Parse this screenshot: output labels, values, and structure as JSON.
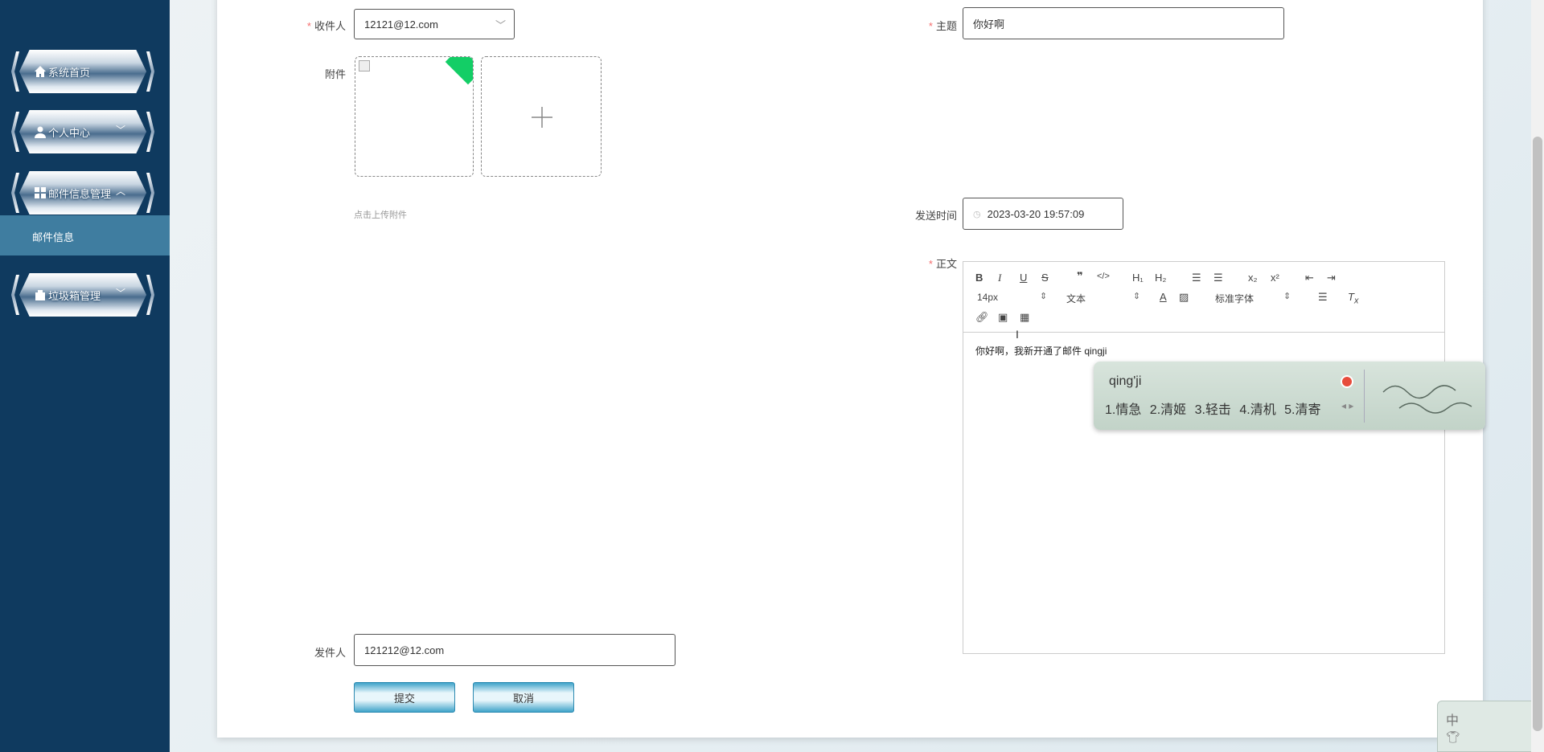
{
  "sidebar": {
    "items": [
      {
        "label": "系统首页",
        "icon": "home-icon"
      },
      {
        "label": "个人中心",
        "icon": "user-icon"
      },
      {
        "label": "邮件信息管理",
        "icon": "grid-icon"
      },
      {
        "label": "垃圾箱管理",
        "icon": "trash-icon"
      }
    ],
    "submenu": {
      "label": "邮件信息"
    }
  },
  "form": {
    "recipient": {
      "label": "收件人",
      "value": "12121@12.com"
    },
    "subject": {
      "label": "主题",
      "value": "你好啊"
    },
    "attachment": {
      "label": "附件",
      "tip": "点击上传附件"
    },
    "send_time": {
      "label": "发送时间",
      "value": "2023-03-20 19:57:09"
    },
    "body": {
      "label": "正文",
      "text": "你好啊，我新开通了邮件 qingji"
    },
    "sender": {
      "label": "发件人",
      "value": "121212@12.com"
    },
    "required_mark": "*",
    "submit_label": "提交",
    "cancel_label": "取消"
  },
  "editor_toolbar": {
    "font_size": "14px",
    "paragraph": "文本",
    "font_family": "标准字体"
  },
  "ime": {
    "pinyin": "qing'ji",
    "candidates": "1.情急  2.清姬  3.轻击  4.清机  5.清寄",
    "mini_label": "中"
  }
}
